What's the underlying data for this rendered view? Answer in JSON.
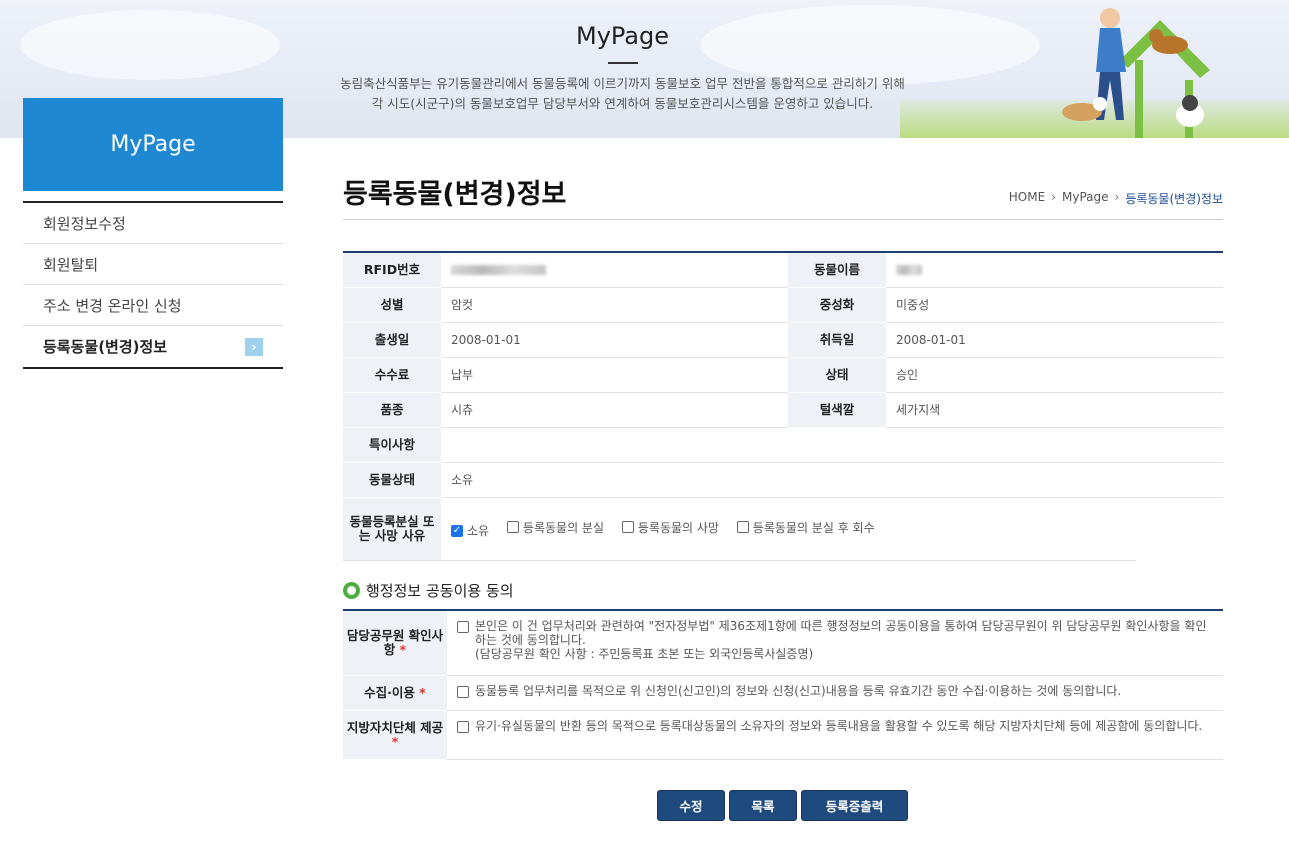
{
  "banner": {
    "title": "MyPage",
    "desc_line1": "농림축산식품부는 유기동물관리에서 동물등록에 이르기까지 동물보호 업무 전반을 통합적으로 관리하기 위해",
    "desc_line2": "각 시도(시군구)의 동물보호업무 담당부서와 연계하여 동물보호관리시스템을 운영하고 있습니다."
  },
  "sidebar": {
    "title": "MyPage",
    "items": [
      {
        "label": "회원정보수정"
      },
      {
        "label": "회원탈퇴"
      },
      {
        "label": "주소 변경 온라인 신청"
      },
      {
        "label": "등록동물(변경)정보"
      }
    ]
  },
  "page": {
    "title": "등록동물(변경)정보",
    "breadcrumb": [
      "HOME",
      "MyPage",
      "등록동물(변경)정보"
    ]
  },
  "info": {
    "rfid_label": "RFID번호",
    "name_label": "동물이름",
    "sex_label": "성별",
    "sex_value": "암컷",
    "neuter_label": "중성화",
    "neuter_value": "미중성",
    "birth_label": "출생일",
    "birth_value": "2008-01-01",
    "acquire_label": "취득일",
    "acquire_value": "2008-01-01",
    "fee_label": "수수료",
    "fee_value": "납부",
    "status_label": "상태",
    "status_value": "승인",
    "breed_label": "품종",
    "breed_value": "시츄",
    "color_label": "털색깔",
    "color_value": "세가지색",
    "note_label": "특이사항",
    "note_value": "",
    "animal_status_label": "동물상태",
    "animal_status_value": "소유",
    "loss_label": "동물등록분실 또는 사망 사유",
    "loss_options": [
      {
        "label": "소유",
        "checked": true
      },
      {
        "label": "등록동물의 분실",
        "checked": false
      },
      {
        "label": "등록동물의 사망",
        "checked": false
      },
      {
        "label": "등록동물의 분실 후 회수",
        "checked": false
      }
    ]
  },
  "consent": {
    "section_title": "행정정보 공동이용 동의",
    "rows": [
      {
        "label": "담당공무원 확인사항",
        "text": "본인은 이 건 업무처리와 관련하여 \"전자정부법\" 제36조제1항에 따른 행정정보의 공동이용을 통하여 담당공무원이 위 담당공무원 확인사항을 확인하는 것에 동의합니다.",
        "sub": "(담당공무원 확인 사항 : 주민등록표 초본 또는 외국인등록사실증명)"
      },
      {
        "label": "수집·이용",
        "text": "동물등록 업무처리를 목적으로 위 신청인(신고인)의 정보와 신청(신고)내용을 등록 유효기간 동안 수집·이용하는 것에 동의합니다.",
        "sub": ""
      },
      {
        "label": "지방자치단체 제공",
        "text": "유기·유실동물의 반환 등의 목적으로 등록대상동물의 소유자의 정보와 등록내용을 활용할 수 있도록 해당 지방자치단체 등에 제공함에 동의합니다.",
        "sub": ""
      }
    ],
    "required_mark": "*"
  },
  "buttons": {
    "edit": "수정",
    "list": "목록",
    "print": "등록증출력"
  }
}
